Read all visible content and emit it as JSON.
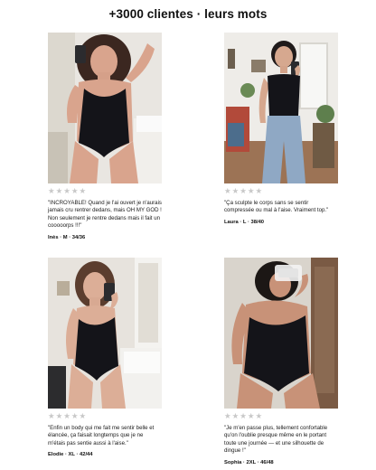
{
  "header": {
    "title": "+3000 clientes · leurs mots"
  },
  "reviews": [
    {
      "rating": 0,
      "stars": [
        "★",
        "★",
        "★",
        "★",
        "★"
      ],
      "quote": "\"INCROYABLE! Quand je l'ai ouvert je n'aurais jamais cru rentrer dedans, mais OH MY GOD ! Non seulement je rentre dedans mais il fait un cooooorps !!!\"",
      "author": "Inès · M · 34/36",
      "photo_alt": "customer photo"
    },
    {
      "rating": 0,
      "stars": [
        "★",
        "★",
        "★",
        "★",
        "★"
      ],
      "quote": "\"Ça sculpte le corps sans se sentir compressée ou mal à l'aise. Vraiment top.\"",
      "author": "Laura · L · 38/40",
      "photo_alt": "customer photo"
    },
    {
      "rating": 0,
      "stars": [
        "★",
        "★",
        "★",
        "★",
        "★"
      ],
      "quote": "\"Enfin un body qui me fait me sentir belle et élancée, ça faisait longtemps que je ne m'étais pas sentie aussi à l'aise.\"",
      "author": "Elodie · XL · 42/44",
      "photo_alt": "customer photo"
    },
    {
      "rating": 0,
      "stars": [
        "★",
        "★",
        "★",
        "★",
        "★"
      ],
      "quote": "\"Je m'en passe plus, tellement confortable qu'on l'oublie presque même en le portant toute une journée — et une silhouette de dingue !\"",
      "author": "Sophia · 2XL · 46/48",
      "photo_alt": "customer photo"
    }
  ],
  "colors": {
    "star_empty": "#c8c8c8",
    "bodysuit": "#141419",
    "skin": "#d9a48d"
  }
}
